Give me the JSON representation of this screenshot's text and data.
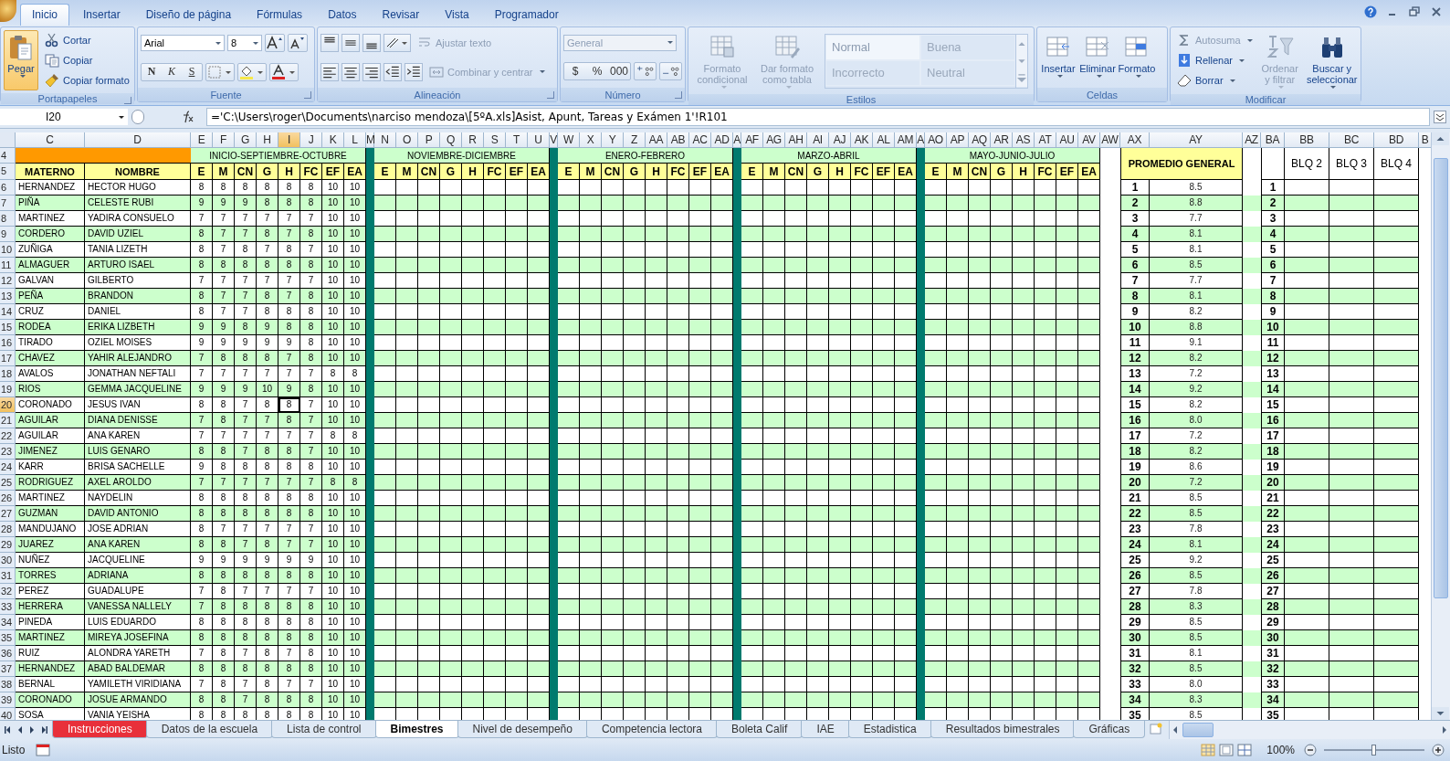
{
  "ribbon_tabs": [
    {
      "label": "Inicio",
      "selected": true
    },
    {
      "label": "Insertar",
      "selected": false
    },
    {
      "label": "Diseño de página",
      "selected": false
    },
    {
      "label": "Fórmulas",
      "selected": false
    },
    {
      "label": "Datos",
      "selected": false
    },
    {
      "label": "Revisar",
      "selected": false
    },
    {
      "label": "Vista",
      "selected": false
    },
    {
      "label": "Programador",
      "selected": false
    }
  ],
  "ribbon": {
    "clipboard": {
      "label": "Portapapeles",
      "paste": "Pegar",
      "items": [
        "Cortar",
        "Copiar",
        "Copiar formato"
      ]
    },
    "font": {
      "label": "Fuente",
      "family": "Arial",
      "size": "8",
      "styles": [
        "N",
        "K",
        "S"
      ]
    },
    "alignment": {
      "label": "Alineación",
      "wrap": {
        "label": "Ajustar texto",
        "disabled": true
      },
      "merge": {
        "label": "Combinar y centrar",
        "disabled": true
      }
    },
    "number": {
      "label": "Número",
      "format": {
        "label": "General",
        "disabled": true
      },
      "symbols": [
        "$",
        "%",
        "000"
      ]
    },
    "styles": {
      "label": "Estilos",
      "buttons": [
        {
          "label": "Formato condicional",
          "disabled": true
        },
        {
          "label": "Dar formato como tabla",
          "disabled": true
        }
      ],
      "gallery": [
        {
          "label": "Normal",
          "selected": true
        },
        {
          "label": "Buena",
          "selected": false
        },
        {
          "label": "Incorrecto",
          "selected": false
        },
        {
          "label": "Neutral",
          "selected": false
        }
      ]
    },
    "cells": {
      "label": "Celdas",
      "buttons": [
        "Insertar",
        "Eliminar",
        "Formato"
      ]
    },
    "editing": {
      "label": "Modificar",
      "items": [
        {
          "label": "Autosuma",
          "disabled": true
        },
        {
          "label": "Rellenar",
          "disabled": false
        },
        {
          "label": "Borrar",
          "disabled": false
        }
      ],
      "buttons": [
        {
          "label": "Ordenar y filtrar",
          "disabled": true
        },
        {
          "label": "Buscar y seleccionar",
          "disabled": false
        }
      ]
    }
  },
  "name_box": "I20",
  "formula": "='C:\\Users\\roger\\Documents\\narciso mendoza\\[5ºA.xls]Asist, Apunt, Tareas y Exámen 1'!R101",
  "columns": [
    {
      "label": "C",
      "selected": false
    },
    {
      "label": "D",
      "selected": false
    },
    {
      "label": "E",
      "selected": false
    },
    {
      "label": "F",
      "selected": false
    },
    {
      "label": "G",
      "selected": false
    },
    {
      "label": "H",
      "selected": false
    },
    {
      "label": "I",
      "selected": true
    },
    {
      "label": "J",
      "selected": false
    },
    {
      "label": "K",
      "selected": false
    },
    {
      "label": "L",
      "selected": false
    },
    {
      "label": "M",
      "selected": false
    },
    {
      "label": "N",
      "selected": false
    },
    {
      "label": "O",
      "selected": false
    },
    {
      "label": "P",
      "selected": false
    },
    {
      "label": "Q",
      "selected": false
    },
    {
      "label": "R",
      "selected": false
    },
    {
      "label": "S",
      "selected": false
    },
    {
      "label": "T",
      "selected": false
    },
    {
      "label": "U",
      "selected": false
    },
    {
      "label": "V",
      "selected": false
    },
    {
      "label": "W",
      "selected": false
    },
    {
      "label": "X",
      "selected": false
    },
    {
      "label": "Y",
      "selected": false
    },
    {
      "label": "Z",
      "selected": false
    },
    {
      "label": "AA",
      "selected": false
    },
    {
      "label": "AB",
      "selected": false
    },
    {
      "label": "AC",
      "selected": false
    },
    {
      "label": "AD",
      "selected": false
    },
    {
      "label": "A",
      "selected": false
    },
    {
      "label": "AF",
      "selected": false
    },
    {
      "label": "AG",
      "selected": false
    },
    {
      "label": "AH",
      "selected": false
    },
    {
      "label": "AI",
      "selected": false
    },
    {
      "label": "AJ",
      "selected": false
    },
    {
      "label": "AK",
      "selected": false
    },
    {
      "label": "AL",
      "selected": false
    },
    {
      "label": "AM",
      "selected": false
    },
    {
      "label": "A",
      "selected": false
    },
    {
      "label": "AO",
      "selected": false
    },
    {
      "label": "AP",
      "selected": false
    },
    {
      "label": "AQ",
      "selected": false
    },
    {
      "label": "AR",
      "selected": false
    },
    {
      "label": "AS",
      "selected": false
    },
    {
      "label": "AT",
      "selected": false
    },
    {
      "label": "AU",
      "selected": false
    },
    {
      "label": "AV",
      "selected": false
    },
    {
      "label": "AW",
      "selected": false
    },
    {
      "label": "AX",
      "selected": false
    },
    {
      "label": "AY",
      "selected": false
    },
    {
      "label": "AZ",
      "selected": false
    },
    {
      "label": "BA",
      "selected": false
    },
    {
      "label": "BB",
      "selected": false
    },
    {
      "label": "BC",
      "selected": false
    },
    {
      "label": "BD",
      "selected": false
    },
    {
      "label": "B",
      "selected": false
    }
  ],
  "header_rows": [
    "4",
    "5"
  ],
  "sheet": {
    "surname_header": "MATERNO",
    "name_header": "NOMBRE",
    "average_header": "PROMEDIO GENERAL",
    "blocks": [
      "BLQ 2",
      "BLQ 3",
      "BLQ 4"
    ],
    "periods": [
      {
        "title": "INICIO-SEPTIEMBRE-OCTUBRE",
        "subjects": [
          "E",
          "M",
          "CN",
          "G",
          "H",
          "FC",
          "EF",
          "EA"
        ]
      },
      {
        "title": "NOVIEMBRE-DICIEMBRE",
        "subjects": [
          "E",
          "M",
          "CN",
          "G",
          "H",
          "FC",
          "EF",
          "EA"
        ]
      },
      {
        "title": "ENERO-FEBRERO",
        "subjects": [
          "E",
          "M",
          "CN",
          "G",
          "H",
          "FC",
          "EF",
          "EA"
        ]
      },
      {
        "title": "MARZO-ABRIL",
        "subjects": [
          "E",
          "M",
          "CN",
          "G",
          "H",
          "FC",
          "EF",
          "EA"
        ]
      },
      {
        "title": "MAYO-JUNIO-JULIO",
        "subjects": [
          "E",
          "M",
          "CN",
          "G",
          "H",
          "FC",
          "EF",
          "EA"
        ]
      }
    ]
  },
  "rows": [
    {
      "number": "6",
      "selected": false,
      "surname": "HERNANDEZ",
      "name": "HECTOR HUGO",
      "grades": [
        "8",
        "8",
        "8",
        "8",
        "8",
        "8",
        "10",
        "10"
      ],
      "rank": "1",
      "average": "8.5",
      "rank2": "1"
    },
    {
      "number": "7",
      "selected": false,
      "surname": "PIÑA",
      "name": "CELESTE RUBI",
      "grades": [
        "9",
        "9",
        "9",
        "8",
        "8",
        "8",
        "10",
        "10"
      ],
      "rank": "2",
      "average": "8.8",
      "rank2": "2"
    },
    {
      "number": "8",
      "selected": false,
      "surname": "MARTINEZ",
      "name": "YADIRA CONSUELO",
      "grades": [
        "7",
        "7",
        "7",
        "7",
        "7",
        "7",
        "10",
        "10"
      ],
      "rank": "3",
      "average": "7.7",
      "rank2": "3"
    },
    {
      "number": "9",
      "selected": false,
      "surname": "CORDERO",
      "name": "DAVID UZIEL",
      "grades": [
        "8",
        "7",
        "7",
        "8",
        "7",
        "8",
        "10",
        "10"
      ],
      "rank": "4",
      "average": "8.1",
      "rank2": "4"
    },
    {
      "number": "10",
      "selected": false,
      "surname": "ZUÑIGA",
      "name": "TANIA LIZETH",
      "grades": [
        "8",
        "7",
        "8",
        "7",
        "8",
        "7",
        "10",
        "10"
      ],
      "rank": "5",
      "average": "8.1",
      "rank2": "5"
    },
    {
      "number": "11",
      "selected": false,
      "surname": "ALMAGUER",
      "name": "ARTURO ISAEL",
      "grades": [
        "8",
        "8",
        "8",
        "8",
        "8",
        "8",
        "10",
        "10"
      ],
      "rank": "6",
      "average": "8.5",
      "rank2": "6"
    },
    {
      "number": "12",
      "selected": false,
      "surname": "GALVAN",
      "name": "GILBERTO",
      "grades": [
        "7",
        "7",
        "7",
        "7",
        "7",
        "7",
        "10",
        "10"
      ],
      "rank": "7",
      "average": "7.7",
      "rank2": "7"
    },
    {
      "number": "13",
      "selected": false,
      "surname": "PEÑA",
      "name": "BRANDON",
      "grades": [
        "8",
        "7",
        "7",
        "8",
        "7",
        "8",
        "10",
        "10"
      ],
      "rank": "8",
      "average": "8.1",
      "rank2": "8"
    },
    {
      "number": "14",
      "selected": false,
      "surname": "CRUZ",
      "name": "DANIEL",
      "grades": [
        "8",
        "7",
        "7",
        "8",
        "8",
        "8",
        "10",
        "10"
      ],
      "rank": "9",
      "average": "8.2",
      "rank2": "9"
    },
    {
      "number": "15",
      "selected": false,
      "surname": "RODEA",
      "name": "ERIKA LIZBETH",
      "grades": [
        "9",
        "9",
        "8",
        "9",
        "8",
        "8",
        "10",
        "10"
      ],
      "rank": "10",
      "average": "8.8",
      "rank2": "10"
    },
    {
      "number": "16",
      "selected": false,
      "surname": "TIRADO",
      "name": "OZIEL MOISES",
      "grades": [
        "9",
        "9",
        "9",
        "9",
        "9",
        "8",
        "10",
        "10"
      ],
      "rank": "11",
      "average": "9.1",
      "rank2": "11"
    },
    {
      "number": "17",
      "selected": false,
      "surname": "CHAVEZ",
      "name": "YAHIR ALEJANDRO",
      "grades": [
        "7",
        "8",
        "8",
        "8",
        "7",
        "8",
        "10",
        "10"
      ],
      "rank": "12",
      "average": "8.2",
      "rank2": "12"
    },
    {
      "number": "18",
      "selected": false,
      "surname": "AVALOS",
      "name": "JONATHAN NEFTALI",
      "grades": [
        "7",
        "7",
        "7",
        "7",
        "7",
        "7",
        "8",
        "8"
      ],
      "rank": "13",
      "average": "7.2",
      "rank2": "13"
    },
    {
      "number": "19",
      "selected": false,
      "surname": "RIOS",
      "name": "GEMMA JACQUELINE",
      "grades": [
        "9",
        "9",
        "9",
        "10",
        "9",
        "8",
        "10",
        "10"
      ],
      "rank": "14",
      "average": "9.2",
      "rank2": "14"
    },
    {
      "number": "20",
      "selected": true,
      "surname": "CORONADO",
      "name": "JESUS IVAN",
      "grades": [
        "8",
        "8",
        "7",
        "8",
        "8",
        "7",
        "10",
        "10"
      ],
      "rank": "15",
      "average": "8.2",
      "rank2": "15"
    },
    {
      "number": "21",
      "selected": false,
      "surname": "AGUILAR",
      "name": "DIANA DENISSE",
      "grades": [
        "7",
        "8",
        "7",
        "7",
        "8",
        "7",
        "10",
        "10"
      ],
      "rank": "16",
      "average": "8.0",
      "rank2": "16"
    },
    {
      "number": "22",
      "selected": false,
      "surname": "AGUILAR",
      "name": "ANA KAREN",
      "grades": [
        "7",
        "7",
        "7",
        "7",
        "7",
        "7",
        "8",
        "8"
      ],
      "rank": "17",
      "average": "7.2",
      "rank2": "17"
    },
    {
      "number": "23",
      "selected": false,
      "surname": "JIMENEZ",
      "name": "LUIS GENARO",
      "grades": [
        "8",
        "8",
        "7",
        "8",
        "8",
        "7",
        "10",
        "10"
      ],
      "rank": "18",
      "average": "8.2",
      "rank2": "18"
    },
    {
      "number": "24",
      "selected": false,
      "surname": "KARR",
      "name": "BRISA SACHELLE",
      "grades": [
        "9",
        "8",
        "8",
        "8",
        "8",
        "8",
        "10",
        "10"
      ],
      "rank": "19",
      "average": "8.6",
      "rank2": "19"
    },
    {
      "number": "25",
      "selected": false,
      "surname": "RODRIGUEZ",
      "name": "AXEL AROLDO",
      "grades": [
        "7",
        "7",
        "7",
        "7",
        "7",
        "7",
        "8",
        "8"
      ],
      "rank": "20",
      "average": "7.2",
      "rank2": "20"
    },
    {
      "number": "26",
      "selected": false,
      "surname": "MARTINEZ",
      "name": "NAYDELIN",
      "grades": [
        "8",
        "8",
        "8",
        "8",
        "8",
        "8",
        "10",
        "10"
      ],
      "rank": "21",
      "average": "8.5",
      "rank2": "21"
    },
    {
      "number": "27",
      "selected": false,
      "surname": "GUZMAN",
      "name": "DAVID ANTONIO",
      "grades": [
        "8",
        "8",
        "8",
        "8",
        "8",
        "8",
        "10",
        "10"
      ],
      "rank": "22",
      "average": "8.5",
      "rank2": "22"
    },
    {
      "number": "28",
      "selected": false,
      "surname": "MANDUJANO",
      "name": "JOSE ADRIAN",
      "grades": [
        "8",
        "7",
        "7",
        "7",
        "7",
        "7",
        "10",
        "10"
      ],
      "rank": "23",
      "average": "7.8",
      "rank2": "23"
    },
    {
      "number": "29",
      "selected": false,
      "surname": "JUAREZ",
      "name": "ANA KAREN",
      "grades": [
        "8",
        "8",
        "7",
        "8",
        "7",
        "7",
        "10",
        "10"
      ],
      "rank": "24",
      "average": "8.1",
      "rank2": "24"
    },
    {
      "number": "30",
      "selected": false,
      "surname": "NUÑEZ",
      "name": "JACQUELINE",
      "grades": [
        "9",
        "9",
        "9",
        "9",
        "9",
        "9",
        "10",
        "10"
      ],
      "rank": "25",
      "average": "9.2",
      "rank2": "25"
    },
    {
      "number": "31",
      "selected": false,
      "surname": "TORRES",
      "name": "ADRIANA",
      "grades": [
        "8",
        "8",
        "8",
        "8",
        "8",
        "8",
        "10",
        "10"
      ],
      "rank": "26",
      "average": "8.5",
      "rank2": "26"
    },
    {
      "number": "32",
      "selected": false,
      "surname": "PEREZ",
      "name": "GUADALUPE",
      "grades": [
        "7",
        "8",
        "7",
        "7",
        "7",
        "7",
        "10",
        "10"
      ],
      "rank": "27",
      "average": "7.8",
      "rank2": "27"
    },
    {
      "number": "33",
      "selected": false,
      "surname": "HERRERA",
      "name": "VANESSA NALLELY",
      "grades": [
        "7",
        "8",
        "8",
        "8",
        "8",
        "8",
        "10",
        "10"
      ],
      "rank": "28",
      "average": "8.3",
      "rank2": "28"
    },
    {
      "number": "34",
      "selected": false,
      "surname": "PINEDA",
      "name": "LUIS EDUARDO",
      "grades": [
        "8",
        "8",
        "8",
        "8",
        "8",
        "8",
        "10",
        "10"
      ],
      "rank": "29",
      "average": "8.5",
      "rank2": "29"
    },
    {
      "number": "35",
      "selected": false,
      "surname": "MARTINEZ",
      "name": "MIREYA JOSEFINA",
      "grades": [
        "8",
        "8",
        "8",
        "8",
        "8",
        "8",
        "10",
        "10"
      ],
      "rank": "30",
      "average": "8.5",
      "rank2": "30"
    },
    {
      "number": "36",
      "selected": false,
      "surname": "RUIZ",
      "name": "ALONDRA YARETH",
      "grades": [
        "7",
        "8",
        "7",
        "8",
        "7",
        "8",
        "10",
        "10"
      ],
      "rank": "31",
      "average": "8.1",
      "rank2": "31"
    },
    {
      "number": "37",
      "selected": false,
      "surname": "HERNANDEZ",
      "name": "ABAD BALDEMAR",
      "grades": [
        "8",
        "8",
        "8",
        "8",
        "8",
        "8",
        "10",
        "10"
      ],
      "rank": "32",
      "average": "8.5",
      "rank2": "32"
    },
    {
      "number": "38",
      "selected": false,
      "surname": "BERNAL",
      "name": "YAMILETH VIRIDIANA",
      "grades": [
        "7",
        "8",
        "7",
        "8",
        "7",
        "7",
        "10",
        "10"
      ],
      "rank": "33",
      "average": "8.0",
      "rank2": "33"
    },
    {
      "number": "39",
      "selected": false,
      "surname": "CORONADO",
      "name": "JOSUE ARMANDO",
      "grades": [
        "8",
        "8",
        "7",
        "8",
        "8",
        "8",
        "10",
        "10"
      ],
      "rank": "34",
      "average": "8.3",
      "rank2": "34"
    },
    {
      "number": "40",
      "selected": false,
      "surname": "SOSA",
      "name": "VANIA YEISHA",
      "grades": [
        "8",
        "8",
        "8",
        "8",
        "8",
        "8",
        "10",
        "10"
      ],
      "rank": "35",
      "average": "8.5",
      "rank2": "35"
    }
  ],
  "sheet_tabs": [
    {
      "label": "Instrucciones",
      "selected": false,
      "color": "#e8303a"
    },
    {
      "label": "Datos de la escuela",
      "selected": false
    },
    {
      "label": "Lista de control",
      "selected": false
    },
    {
      "label": "Bimestres",
      "selected": true
    },
    {
      "label": "Nivel de desempeño",
      "selected": false
    },
    {
      "label": "Competencia lectora",
      "selected": false
    },
    {
      "label": "Boleta Calif",
      "selected": false
    },
    {
      "label": "IAE",
      "selected": false
    },
    {
      "label": "Estadistica",
      "selected": false
    },
    {
      "label": "Resultados bimestrales",
      "selected": false
    },
    {
      "label": "Gráficas",
      "selected": false
    }
  ],
  "status": {
    "text": "Listo",
    "zoom": "100%",
    "level": 0.5
  }
}
